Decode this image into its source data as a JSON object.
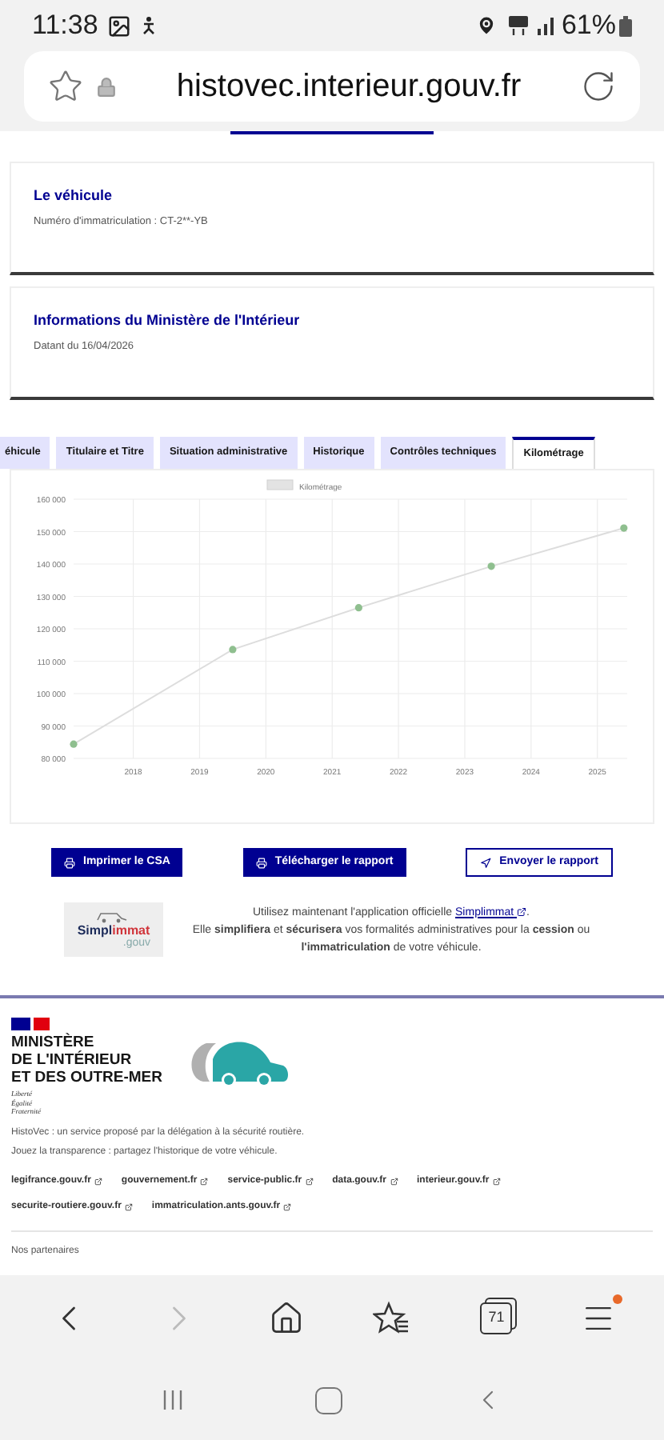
{
  "status_bar": {
    "time": "11:38",
    "battery": "61%"
  },
  "browser": {
    "url": "histovec.interieur.gouv.fr",
    "tab_count": "71"
  },
  "cards": [
    {
      "title": "Le véhicule",
      "text": "Numéro d'immatriculation : CT-2**-YB"
    },
    {
      "title": "Informations du Ministère de l'Intérieur",
      "text": "Datant du 16/04/2026"
    }
  ],
  "tabs": [
    {
      "label": "éhicule",
      "selected": false
    },
    {
      "label": "Titulaire et Titre",
      "selected": false
    },
    {
      "label": "Situation administrative",
      "selected": false
    },
    {
      "label": "Historique",
      "selected": false
    },
    {
      "label": "Contrôles techniques",
      "selected": false
    },
    {
      "label": "Kilométrage",
      "selected": true
    }
  ],
  "chart": {
    "chart_data": {
      "type": "line",
      "grid": true,
      "x": [
        2017.1,
        2019.5,
        2021.4,
        2023.4,
        2025.4
      ],
      "xlim": [
        2017.1,
        2025.45
      ],
      "ylim": [
        80000,
        160000
      ],
      "xticks": [
        2018,
        2019,
        2020,
        2021,
        2022,
        2023,
        2024,
        2025
      ],
      "yticks": [
        {
          "value": 80000,
          "label": "80 000"
        },
        {
          "value": 90000,
          "label": "90 000"
        },
        {
          "value": 100000,
          "label": "100 000"
        },
        {
          "value": 110000,
          "label": "110 000"
        },
        {
          "value": 120000,
          "label": "120 000"
        },
        {
          "value": 130000,
          "label": "130 000"
        },
        {
          "value": 140000,
          "label": "140 000"
        },
        {
          "value": 150000,
          "label": "150 000"
        },
        {
          "value": 160000,
          "label": "160 000"
        }
      ],
      "series": [
        {
          "name": "Kilométrage",
          "color": "#8fbf8f",
          "marker": true,
          "values": [
            84400,
            113600,
            126500,
            139300,
            151100
          ]
        }
      ]
    }
  },
  "buttons": [
    {
      "label": "Imprimer le CSA",
      "kind": "primary"
    },
    {
      "label": "Télécharger le rapport",
      "kind": "primary"
    },
    {
      "label": "Envoyer le rapport",
      "kind": "secondary"
    }
  ],
  "promo": {
    "logo": {
      "part_1": "Simpl",
      "part_2": "immat",
      "suffix": ".gouv"
    },
    "intro": "Utilisez maintenant l'application officielle",
    "link": "Simplimmat",
    "end": ".",
    "text": "Elle **simplifiera** et **sécurisera** vos formalités administratives pour la **cession** ou **l'immatriculation** de votre véhicule."
  },
  "footer": {
    "ministry": [
      "MINISTÈRE",
      "DE L'INTÉRIEUR",
      "ET DES OUTRE-MER"
    ],
    "motto": [
      "Liberté",
      "Égalité",
      "Fraternité"
    ],
    "description": [
      "HistoVec : un service proposé par la délégation à la sécurité routière.",
      "Jouez la transparence : partagez l'historique de votre véhicule."
    ],
    "links": [
      "legifrance.gouv.fr",
      "gouvernement.fr",
      "service-public.fr",
      "data.gouv.fr",
      "interieur.gouv.fr",
      "securite-routiere.gouv.fr",
      "immatriculation.ants.gouv.fr"
    ],
    "partners_title": "Nos partenaires"
  }
}
